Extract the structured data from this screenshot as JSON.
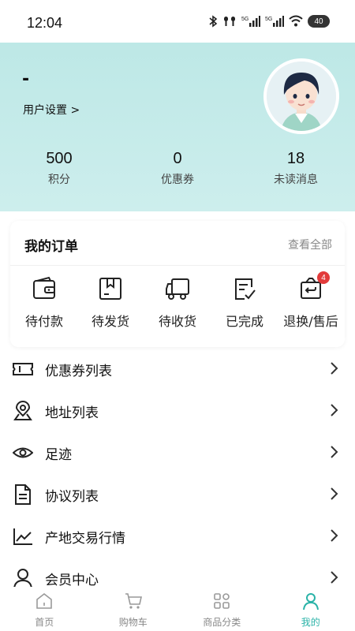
{
  "status_bar": {
    "time": "12:04",
    "battery": "40"
  },
  "profile": {
    "nickname": "-",
    "settings_link": "用户设置 >",
    "stats": [
      {
        "value": "500",
        "label": "积分"
      },
      {
        "value": "0",
        "label": "优惠券"
      },
      {
        "value": "18",
        "label": "未读消息"
      }
    ]
  },
  "orders": {
    "title": "我的订单",
    "view_all": "查看全部",
    "items": [
      {
        "label": "待付款",
        "icon": "wallet-icon"
      },
      {
        "label": "待发货",
        "icon": "package-icon"
      },
      {
        "label": "待收货",
        "icon": "truck-icon"
      },
      {
        "label": "已完成",
        "icon": "checklist-icon"
      },
      {
        "label": "退换/售后",
        "icon": "return-icon",
        "badge": "4"
      }
    ]
  },
  "menu": [
    {
      "label": "优惠券列表",
      "icon": "ticket-icon"
    },
    {
      "label": "地址列表",
      "icon": "location-pin-icon"
    },
    {
      "label": "足迹",
      "icon": "eye-icon"
    },
    {
      "label": "协议列表",
      "icon": "document-icon"
    },
    {
      "label": "产地交易行情",
      "icon": "line-chart-icon"
    },
    {
      "label": "会员中心",
      "icon": "user-icon"
    }
  ],
  "tabs": [
    {
      "label": "首页",
      "icon": "home-icon"
    },
    {
      "label": "购物车",
      "icon": "cart-icon"
    },
    {
      "label": "商品分类",
      "icon": "category-grid-icon"
    },
    {
      "label": "我的",
      "icon": "profile-icon",
      "active": true
    }
  ],
  "colors": {
    "accent": "#2bb3a8",
    "header_bg": "#c6ebea",
    "badge": "#e23b3b"
  }
}
